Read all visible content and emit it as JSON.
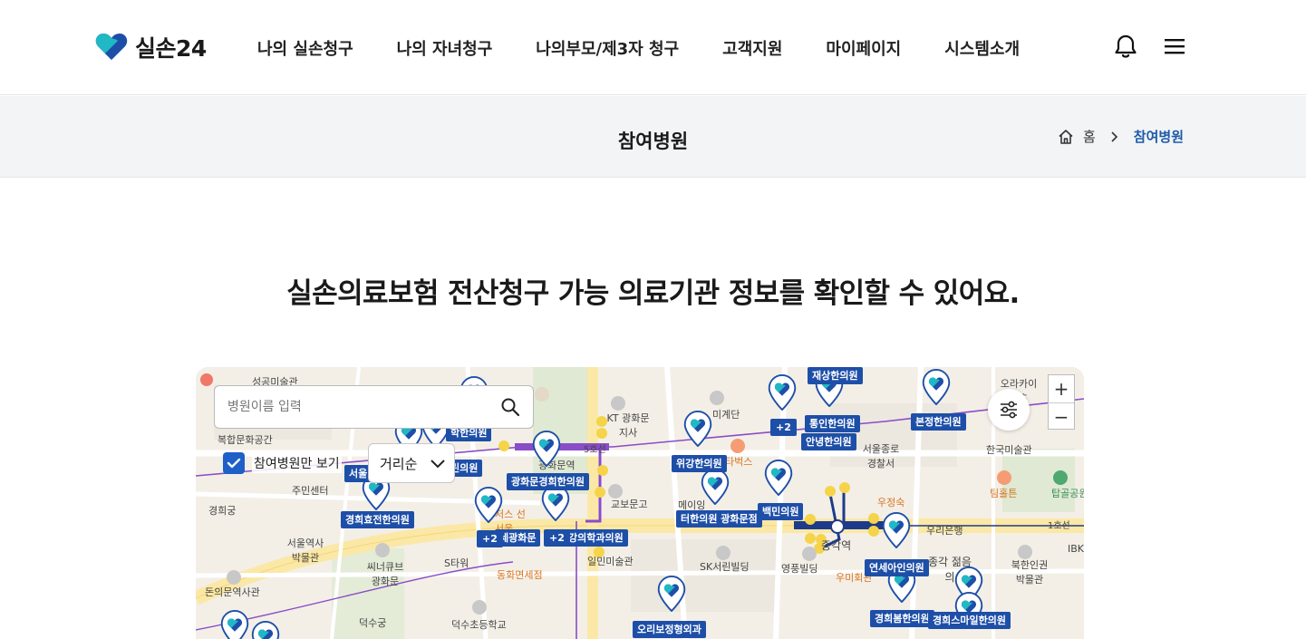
{
  "brand": {
    "name": "실손24",
    "logo_colors": [
      "#1fb8c4",
      "#1e4fa8"
    ]
  },
  "nav": {
    "items": [
      {
        "label": "나의 실손청구"
      },
      {
        "label": "나의 자녀청구"
      },
      {
        "label": "나의부모/제3자 청구"
      },
      {
        "label": "고객지원"
      },
      {
        "label": "마이페이지"
      },
      {
        "label": "시스템소개"
      }
    ],
    "icons": [
      "bell-icon",
      "menu-icon"
    ]
  },
  "page": {
    "title": "참여병원",
    "breadcrumb": {
      "home": "홈",
      "current": "참여병원"
    },
    "headline": "실손의료보험 전산청구 가능 의료기관 정보를 확인할 수 있어요."
  },
  "map": {
    "search_placeholder": "병원이름 입력",
    "checkbox_label": "참여병원만 보기",
    "checkbox_checked": true,
    "sort_label": "거리순",
    "zoom_in": "+",
    "zoom_out": "−",
    "hospital_labels": [
      "경희효전한의원",
      "광화문경희한의원",
      "위강한의원",
      "터한의원 광화문점",
      "백민의원",
      "통인한의원",
      "안녕한의원",
      "본정한의원",
      "연세아인의원",
      "경희봄한의원",
      "경희스마일한의원",
      "강의학과의원",
      "세광화문",
      "린의원",
      "학한의원",
      "재상한의원",
      "오리보정형외과",
      "서울",
      "학한의원"
    ],
    "cluster_counts": [
      "+2",
      "+2",
      "+2"
    ],
    "places": [
      "성공미술관",
      "복합문화공간",
      "주민센터",
      "경희궁",
      "서울역사 박물관",
      "씨너큐브 광화문",
      "돈의문역사관",
      "덕수궁",
      "덕수초등학교",
      "S타워",
      "일민미술관",
      "동화면세점",
      "교보문고",
      "KT 광화문지사",
      "광화문역",
      "SK서린빌딩",
      "영풍빌딩",
      "종각역",
      "우미회관",
      "종각 젊음의",
      "서울종로 경찰서",
      "우정숙",
      "팀홀튼",
      "한국미술관",
      "탑골공원",
      "북한인권 박물관",
      "오라카이 윈츠",
      "우리은행",
      "1호선",
      "5호선",
      "미계단",
      "타벅스",
      "메이잉",
      "저스 선서울",
      "IBK"
    ]
  }
}
